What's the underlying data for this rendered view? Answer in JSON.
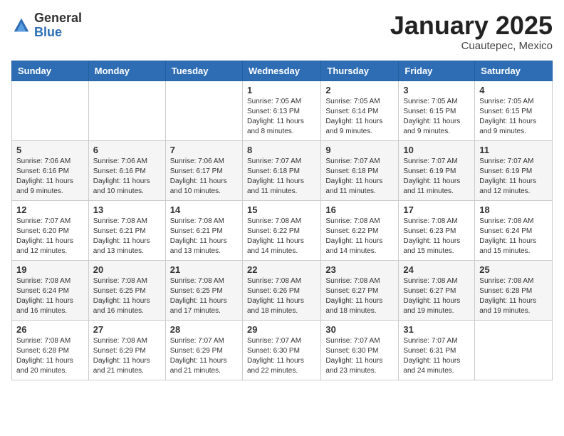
{
  "header": {
    "logo_general": "General",
    "logo_blue": "Blue",
    "month_title": "January 2025",
    "location": "Cuautepec, Mexico"
  },
  "days_of_week": [
    "Sunday",
    "Monday",
    "Tuesday",
    "Wednesday",
    "Thursday",
    "Friday",
    "Saturday"
  ],
  "weeks": [
    [
      {
        "day": "",
        "text": ""
      },
      {
        "day": "",
        "text": ""
      },
      {
        "day": "",
        "text": ""
      },
      {
        "day": "1",
        "text": "Sunrise: 7:05 AM\nSunset: 6:13 PM\nDaylight: 11 hours and 8 minutes."
      },
      {
        "day": "2",
        "text": "Sunrise: 7:05 AM\nSunset: 6:14 PM\nDaylight: 11 hours and 9 minutes."
      },
      {
        "day": "3",
        "text": "Sunrise: 7:05 AM\nSunset: 6:15 PM\nDaylight: 11 hours and 9 minutes."
      },
      {
        "day": "4",
        "text": "Sunrise: 7:05 AM\nSunset: 6:15 PM\nDaylight: 11 hours and 9 minutes."
      }
    ],
    [
      {
        "day": "5",
        "text": "Sunrise: 7:06 AM\nSunset: 6:16 PM\nDaylight: 11 hours and 9 minutes."
      },
      {
        "day": "6",
        "text": "Sunrise: 7:06 AM\nSunset: 6:16 PM\nDaylight: 11 hours and 10 minutes."
      },
      {
        "day": "7",
        "text": "Sunrise: 7:06 AM\nSunset: 6:17 PM\nDaylight: 11 hours and 10 minutes."
      },
      {
        "day": "8",
        "text": "Sunrise: 7:07 AM\nSunset: 6:18 PM\nDaylight: 11 hours and 11 minutes."
      },
      {
        "day": "9",
        "text": "Sunrise: 7:07 AM\nSunset: 6:18 PM\nDaylight: 11 hours and 11 minutes."
      },
      {
        "day": "10",
        "text": "Sunrise: 7:07 AM\nSunset: 6:19 PM\nDaylight: 11 hours and 11 minutes."
      },
      {
        "day": "11",
        "text": "Sunrise: 7:07 AM\nSunset: 6:19 PM\nDaylight: 11 hours and 12 minutes."
      }
    ],
    [
      {
        "day": "12",
        "text": "Sunrise: 7:07 AM\nSunset: 6:20 PM\nDaylight: 11 hours and 12 minutes."
      },
      {
        "day": "13",
        "text": "Sunrise: 7:08 AM\nSunset: 6:21 PM\nDaylight: 11 hours and 13 minutes."
      },
      {
        "day": "14",
        "text": "Sunrise: 7:08 AM\nSunset: 6:21 PM\nDaylight: 11 hours and 13 minutes."
      },
      {
        "day": "15",
        "text": "Sunrise: 7:08 AM\nSunset: 6:22 PM\nDaylight: 11 hours and 14 minutes."
      },
      {
        "day": "16",
        "text": "Sunrise: 7:08 AM\nSunset: 6:22 PM\nDaylight: 11 hours and 14 minutes."
      },
      {
        "day": "17",
        "text": "Sunrise: 7:08 AM\nSunset: 6:23 PM\nDaylight: 11 hours and 15 minutes."
      },
      {
        "day": "18",
        "text": "Sunrise: 7:08 AM\nSunset: 6:24 PM\nDaylight: 11 hours and 15 minutes."
      }
    ],
    [
      {
        "day": "19",
        "text": "Sunrise: 7:08 AM\nSunset: 6:24 PM\nDaylight: 11 hours and 16 minutes."
      },
      {
        "day": "20",
        "text": "Sunrise: 7:08 AM\nSunset: 6:25 PM\nDaylight: 11 hours and 16 minutes."
      },
      {
        "day": "21",
        "text": "Sunrise: 7:08 AM\nSunset: 6:25 PM\nDaylight: 11 hours and 17 minutes."
      },
      {
        "day": "22",
        "text": "Sunrise: 7:08 AM\nSunset: 6:26 PM\nDaylight: 11 hours and 18 minutes."
      },
      {
        "day": "23",
        "text": "Sunrise: 7:08 AM\nSunset: 6:27 PM\nDaylight: 11 hours and 18 minutes."
      },
      {
        "day": "24",
        "text": "Sunrise: 7:08 AM\nSunset: 6:27 PM\nDaylight: 11 hours and 19 minutes."
      },
      {
        "day": "25",
        "text": "Sunrise: 7:08 AM\nSunset: 6:28 PM\nDaylight: 11 hours and 19 minutes."
      }
    ],
    [
      {
        "day": "26",
        "text": "Sunrise: 7:08 AM\nSunset: 6:28 PM\nDaylight: 11 hours and 20 minutes."
      },
      {
        "day": "27",
        "text": "Sunrise: 7:08 AM\nSunset: 6:29 PM\nDaylight: 11 hours and 21 minutes."
      },
      {
        "day": "28",
        "text": "Sunrise: 7:07 AM\nSunset: 6:29 PM\nDaylight: 11 hours and 21 minutes."
      },
      {
        "day": "29",
        "text": "Sunrise: 7:07 AM\nSunset: 6:30 PM\nDaylight: 11 hours and 22 minutes."
      },
      {
        "day": "30",
        "text": "Sunrise: 7:07 AM\nSunset: 6:30 PM\nDaylight: 11 hours and 23 minutes."
      },
      {
        "day": "31",
        "text": "Sunrise: 7:07 AM\nSunset: 6:31 PM\nDaylight: 11 hours and 24 minutes."
      },
      {
        "day": "",
        "text": ""
      }
    ]
  ]
}
